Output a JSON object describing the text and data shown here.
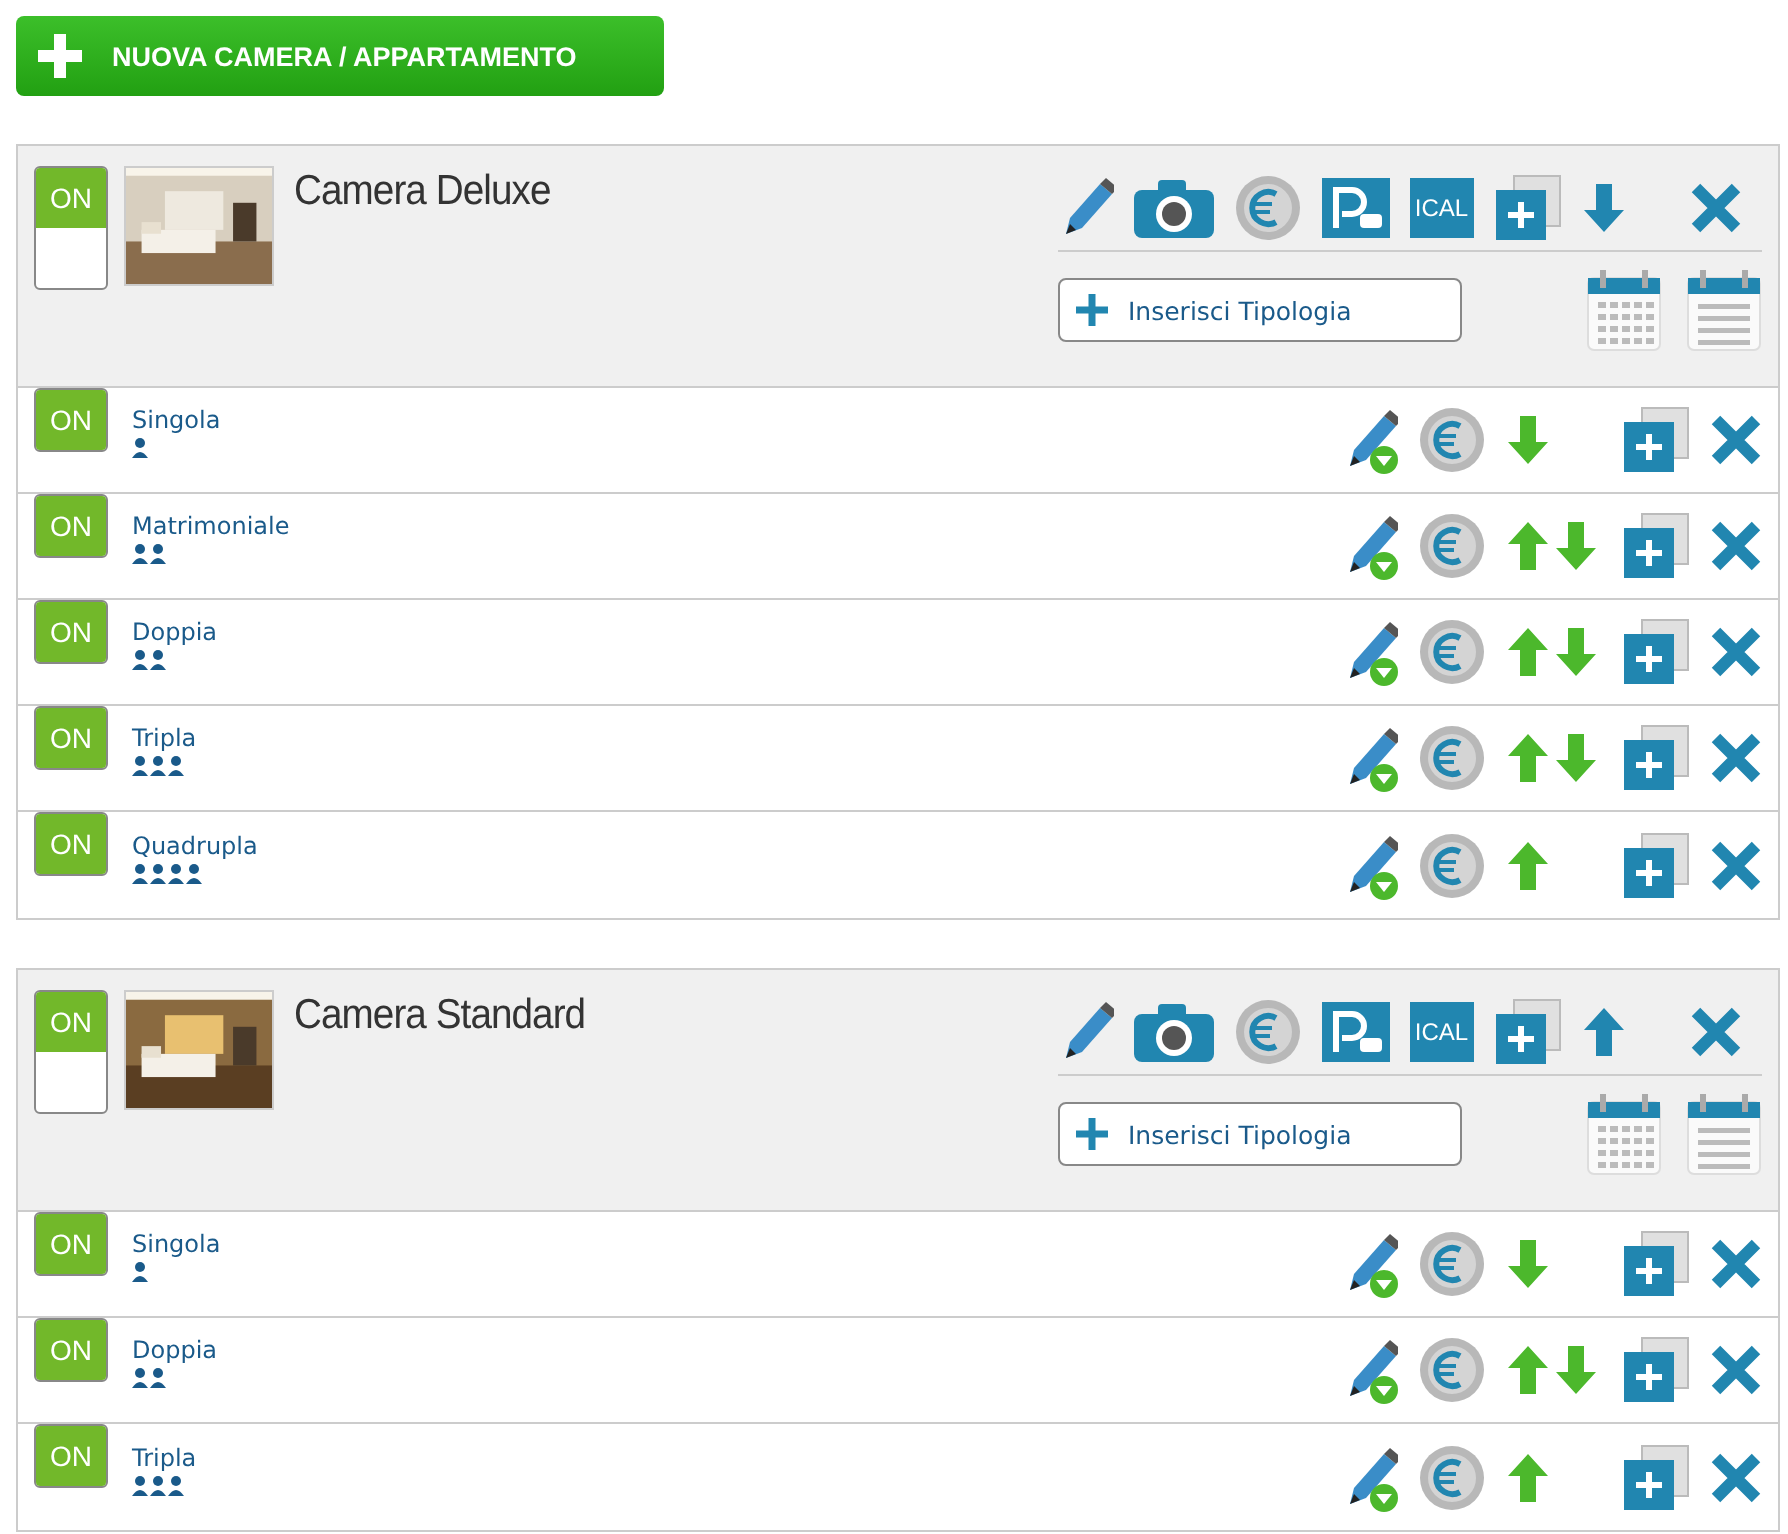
{
  "new_button": "NUOVA CAMERA / APPARTAMENTO",
  "rooms": [
    {
      "name": "Camera Deluxe",
      "toggle": "ON",
      "on": true,
      "ical": "ICAL",
      "move_up": false,
      "move_down": true,
      "add_type": "Inserisci Tipologia",
      "types": [
        {
          "name": "Singola",
          "toggle": "ON",
          "on": true,
          "kind": "single",
          "move_up": false,
          "move_down": true
        },
        {
          "name": "Matrimoniale",
          "toggle": "ON",
          "on": true,
          "kind": "double",
          "move_up": true,
          "move_down": true
        },
        {
          "name": "Doppia",
          "toggle": "ON",
          "on": true,
          "kind": "double",
          "move_up": true,
          "move_down": true
        },
        {
          "name": "Tripla",
          "toggle": "ON",
          "on": true,
          "kind": "triple",
          "move_up": true,
          "move_down": true
        },
        {
          "name": "Quadrupla",
          "toggle": "ON",
          "on": true,
          "kind": "quad",
          "move_up": true,
          "move_down": false
        }
      ]
    },
    {
      "name": "Camera Standard",
      "toggle": "ON",
      "on": true,
      "ical": "ICAL",
      "move_up": true,
      "move_down": false,
      "add_type": "Inserisci Tipologia",
      "types": [
        {
          "name": "Singola",
          "toggle": "ON",
          "on": true,
          "kind": "single",
          "move_up": false,
          "move_down": true
        },
        {
          "name": "Doppia",
          "toggle": "ON",
          "on": true,
          "kind": "double",
          "move_up": true,
          "move_down": true
        },
        {
          "name": "Tripla",
          "toggle": "ON",
          "on": true,
          "kind": "triple",
          "move_up": true,
          "move_down": false
        }
      ]
    }
  ]
}
